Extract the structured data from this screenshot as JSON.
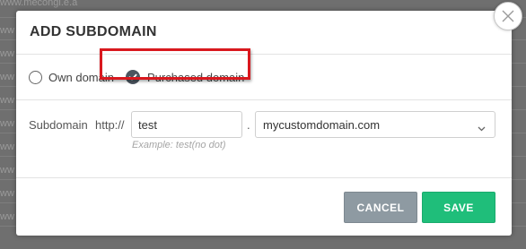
{
  "background": {
    "row_texts": [
      "www.mecongi.e.a",
      "ww",
      "ww",
      "ww",
      "ww",
      "ww",
      "ww",
      "ww",
      "ww",
      "ww"
    ]
  },
  "modal": {
    "title": "ADD SUBDOMAIN",
    "close_icon": "close-icon"
  },
  "domain_type": {
    "options": [
      {
        "label": "Own domain",
        "selected": false
      },
      {
        "label": "Purchased domain",
        "selected": true
      }
    ],
    "highlight_color": "#d9181e"
  },
  "subdomain": {
    "label": "Subdomain",
    "prefix": "http://",
    "input_value": "test",
    "separator": ".",
    "selected_domain": "mycustomdomain.com",
    "hint": "Example: test(no dot)"
  },
  "footer": {
    "cancel_label": "CANCEL",
    "save_label": "SAVE",
    "cancel_color": "#8e9aa2",
    "save_color": "#1fbe7a"
  }
}
